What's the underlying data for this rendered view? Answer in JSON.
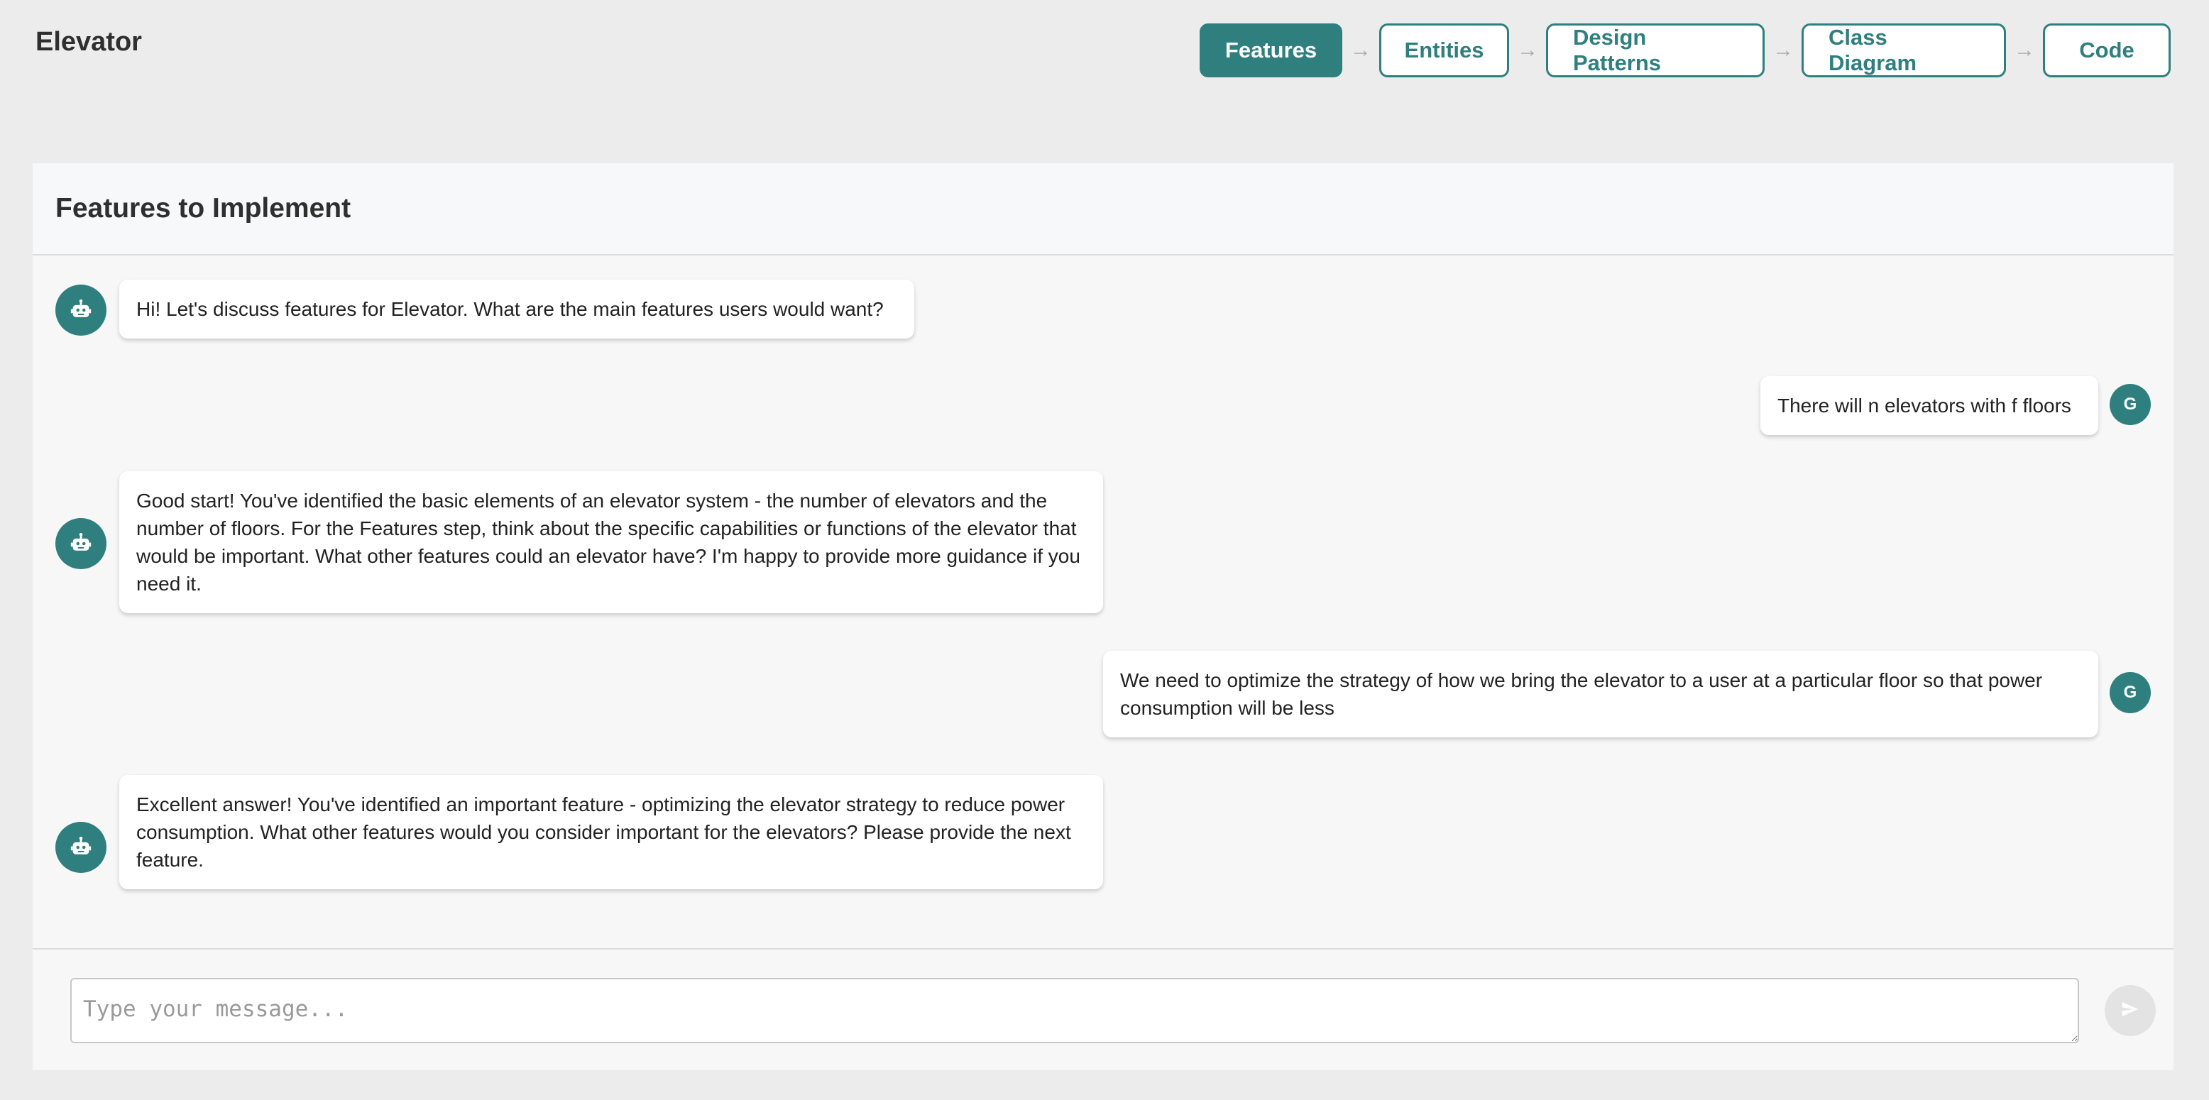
{
  "app": {
    "title": "Elevator"
  },
  "steps": [
    {
      "label": "Features",
      "active": true
    },
    {
      "label": "Entities",
      "active": false
    },
    {
      "label": "Design Patterns",
      "active": false
    },
    {
      "label": "Class Diagram",
      "active": false
    },
    {
      "label": "Code",
      "active": false
    }
  ],
  "step_arrow": "→",
  "panel": {
    "title": "Features to Implement"
  },
  "messages": [
    {
      "role": "bot",
      "icon": "robot-icon",
      "text": "Hi! Let's discuss features for Elevator. What are the main features users would want?"
    },
    {
      "role": "user",
      "avatar": "G",
      "text": "There will n elevators with f floors"
    },
    {
      "role": "bot",
      "icon": "robot-icon",
      "text": "Good start! You've identified the basic elements of an elevator system - the number of elevators and the number of floors. For the Features step, think about the specific capabilities or functions of the elevator that would be important. What other features could an elevator have? I'm happy to provide more guidance if you need it."
    },
    {
      "role": "user",
      "avatar": "G",
      "text": "We need to optimize the strategy of how we bring the elevator to a user at a particular floor so that power consumption will be less"
    },
    {
      "role": "bot",
      "icon": "robot-icon",
      "text": "Excellent answer! You've identified an important feature - optimizing the elevator strategy to reduce power consumption. What other features would you consider important for the elevators? Please provide the next feature."
    }
  ],
  "composer": {
    "placeholder": "Type your message...",
    "value": "",
    "send_icon": "send-icon"
  },
  "colors": {
    "accent": "#2f7f7f",
    "background": "#ececec",
    "panel": "#f7f7f7"
  }
}
